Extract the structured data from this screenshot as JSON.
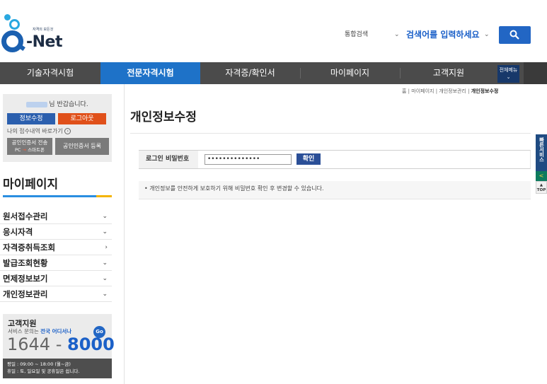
{
  "header": {
    "logo_tagline": "자격의 모든것",
    "logo_text": "-Net",
    "search_scope": "통합검색",
    "search_placeholder": "검색어를 입력하세요"
  },
  "nav": {
    "items": [
      {
        "label": "기술자격시험"
      },
      {
        "label": "전문자격시험"
      },
      {
        "label": "자격증/확인서"
      },
      {
        "label": "마이페이지"
      },
      {
        "label": "고객지원"
      }
    ],
    "all_menu": "전체메뉴"
  },
  "sidebar": {
    "welcome": "님 반갑습니다.",
    "edit_info": "정보수정",
    "logout": "로그아웃",
    "shortcut": "나의 접수내역 바로가기",
    "cert_send_line1": "공인인증서 전송",
    "cert_send_pc": "PC",
    "cert_send_arrow": "→",
    "cert_send_phone": "스마트폰",
    "cert_register": "공인인증서 등록",
    "section_title": "마이페이지",
    "menu": [
      {
        "label": "원서접수관리",
        "arrow": "⌄"
      },
      {
        "label": "응시자격",
        "arrow": "⌄"
      },
      {
        "label": "자격증취득조회",
        "arrow": "›"
      },
      {
        "label": "발급조회현황",
        "arrow": "⌄"
      },
      {
        "label": "면제정보보기",
        "arrow": "⌄"
      },
      {
        "label": "개인정보관리",
        "arrow": "⌄"
      }
    ],
    "cs": {
      "title": "고객지원",
      "sub_prefix": "서비스 문의는 ",
      "sub_highlight": "전국 어디서나",
      "go": "Go",
      "phone_prefix": "1644 - ",
      "phone_highlight": "8000",
      "hours_line1": "평일 : 09:00 ~ 18:00 (월~금)",
      "hours_line2": "휴일 : 토, 일요일 및 공휴일은 쉽니다."
    }
  },
  "main": {
    "breadcrumb": {
      "home": "홈",
      "mypage": "마이페이지",
      "privacy": "개인정보관리",
      "current": "개인정보수정"
    },
    "page_title": "개인정보수정",
    "login_label": "로그인 비밀번호",
    "password_value": "••••••••••••••",
    "confirm": "확인",
    "notice": "개인정보를 안전하게 보호하기 위해 비밀번호 확인 후 변경할 수 있습니다."
  },
  "quick": {
    "service": "빠른서비스",
    "arrow": "<",
    "top": "TOP"
  },
  "colors": {
    "nav_bg": "#4b4b4b",
    "nav_active": "#1e72c8",
    "brand_blue": "#2266c4",
    "logout_orange": "#e0501a"
  }
}
